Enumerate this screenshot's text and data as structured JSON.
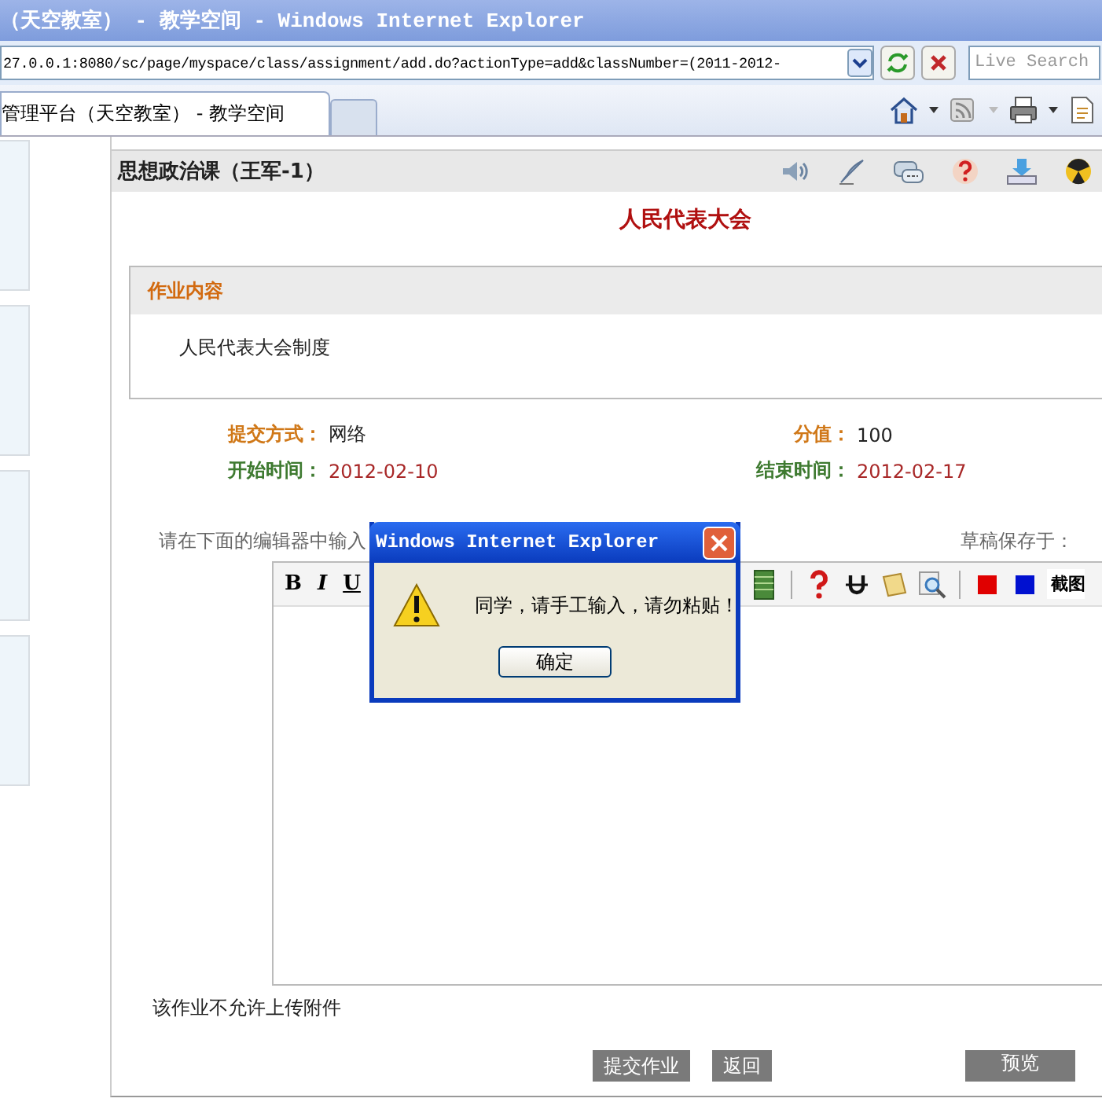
{
  "window": {
    "title": "（天空教室） - 教学空间 - Windows Internet Explorer"
  },
  "address_bar": {
    "value": "27.0.0.1:8080/sc/page/myspace/class/assignment/add.do?actionType=add&classNumber=(2011-2012-"
  },
  "search": {
    "placeholder": "Live Search"
  },
  "tabs": [
    {
      "label": "管理平台（天空教室） - 教学空间",
      "selected": true
    }
  ],
  "course": {
    "title": "思想政治课（王军-1）"
  },
  "assignment": {
    "title": "人民代表大会",
    "content_heading": "作业内容",
    "content": "人民代表大会制度"
  },
  "fields": [
    {
      "label": "提交方式：",
      "value": "网络",
      "kind": "info"
    },
    {
      "label": "分值：",
      "value": "100",
      "kind": "info"
    },
    {
      "label": "开始时间：",
      "value": "2012-02-10",
      "kind": "date"
    },
    {
      "label": "结束时间：",
      "value": "2012-02-17",
      "kind": "date"
    }
  ],
  "editor": {
    "prompt": "请在下面的编辑器中输入",
    "draft_label": "草稿保存于：",
    "format_keys": [
      "B",
      "I",
      "U"
    ],
    "screenshot_label": "截图"
  },
  "attachment_note": "该作业不允许上传附件",
  "buttons": [
    {
      "label": "提交作业",
      "kind": "main"
    },
    {
      "label": "返回",
      "kind": "main"
    },
    {
      "label": "预览",
      "kind": "side"
    }
  ],
  "dialog": {
    "title": "Windows Internet Explorer",
    "message": "同学，请手工输入，请勿粘贴！",
    "ok": "确定"
  }
}
